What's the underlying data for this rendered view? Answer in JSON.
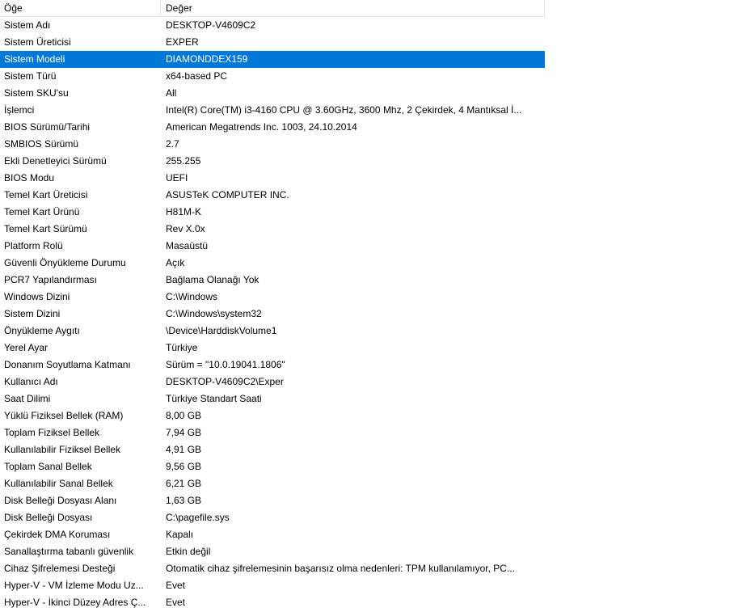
{
  "columns": {
    "item": "Öğe",
    "value": "Değer"
  },
  "selected_index": 2,
  "rows": [
    {
      "item": "Sistem Adı",
      "value": "DESKTOP-V4609C2"
    },
    {
      "item": "Sistem Üreticisi",
      "value": "EXPER"
    },
    {
      "item": "Sistem Modeli",
      "value": "DIAMONDDEX159"
    },
    {
      "item": "Sistem Türü",
      "value": "x64-based PC"
    },
    {
      "item": "Sistem SKU'su",
      "value": "All"
    },
    {
      "item": "İşlemci",
      "value": "Intel(R) Core(TM) i3-4160 CPU @ 3.60GHz, 3600 Mhz, 2 Çekirdek, 4 Mantıksal İ..."
    },
    {
      "item": "BIOS Sürümü/Tarihi",
      "value": "American Megatrends Inc. 1003, 24.10.2014"
    },
    {
      "item": "SMBIOS Sürümü",
      "value": "2.7"
    },
    {
      "item": "Ekli Denetleyici Sürümü",
      "value": "255.255"
    },
    {
      "item": "BIOS Modu",
      "value": "UEFI"
    },
    {
      "item": "Temel Kart Üreticisi",
      "value": "ASUSTeK COMPUTER INC."
    },
    {
      "item": "Temel Kart Ürünü",
      "value": "H81M-K"
    },
    {
      "item": "Temel Kart Sürümü",
      "value": "Rev X.0x"
    },
    {
      "item": "Platform Rolü",
      "value": "Masaüstü"
    },
    {
      "item": "Güvenli Önyükleme Durumu",
      "value": "Açık"
    },
    {
      "item": "PCR7 Yapılandırması",
      "value": "Bağlama Olanağı Yok"
    },
    {
      "item": "Windows Dizini",
      "value": "C:\\Windows"
    },
    {
      "item": "Sistem Dizini",
      "value": "C:\\Windows\\system32"
    },
    {
      "item": "Önyükleme Aygıtı",
      "value": "\\Device\\HarddiskVolume1"
    },
    {
      "item": "Yerel Ayar",
      "value": "Türkiye"
    },
    {
      "item": "Donanım Soyutlama Katmanı",
      "value": "Sürüm = \"10.0.19041.1806\""
    },
    {
      "item": "Kullanıcı Adı",
      "value": "DESKTOP-V4609C2\\Exper"
    },
    {
      "item": "Saat Dilimi",
      "value": "Türkiye Standart Saati"
    },
    {
      "item": "Yüklü Fiziksel Bellek (RAM)",
      "value": "8,00 GB"
    },
    {
      "item": "Toplam Fiziksel Bellek",
      "value": "7,94 GB"
    },
    {
      "item": "Kullanılabilir Fiziksel Bellek",
      "value": "4,91 GB"
    },
    {
      "item": "Toplam Sanal Bellek",
      "value": "9,56 GB"
    },
    {
      "item": "Kullanılabilir Sanal Bellek",
      "value": "6,21 GB"
    },
    {
      "item": "Disk Belleği Dosyası Alanı",
      "value": "1,63 GB"
    },
    {
      "item": "Disk Belleği Dosyası",
      "value": "C:\\pagefile.sys"
    },
    {
      "item": "Çekirdek DMA Koruması",
      "value": "Kapalı"
    },
    {
      "item": "Sanallaştırma tabanlı güvenlik",
      "value": "Etkin değil"
    },
    {
      "item": "Cihaz Şifrelemesi Desteği",
      "value": "Otomatik cihaz şifrelemesinin başarısız olma nedenleri: TPM kullanılamıyor, PC..."
    },
    {
      "item": "Hyper-V - VM İzleme Modu Uz...",
      "value": "Evet"
    },
    {
      "item": "Hyper-V - İkinci Düzey Adres Ç...",
      "value": "Evet"
    }
  ]
}
